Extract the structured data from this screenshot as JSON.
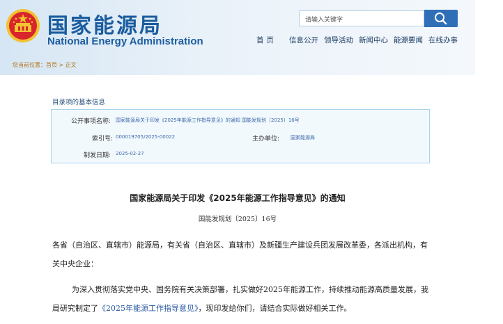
{
  "header": {
    "logo_cn": "国家能源局",
    "logo_en": "National Energy Administration",
    "emblem_icon": "national-emblem-icon",
    "search_placeholder": "请输入关键字",
    "search_icon": "search-icon",
    "nav": [
      "首页",
      "信息公开",
      "领导活动",
      "新闻中心",
      "能源要闻",
      "在线办事"
    ],
    "breadcrumb": "您当前位置：首页 > 正文",
    "colors": {
      "brand_blue": "#1a5c9e",
      "search_button": "#2f6fb7",
      "emblem_red": "#d8262c",
      "emblem_gold": "#f2c230"
    }
  },
  "info": {
    "section_title": "目录项的基本信息",
    "rows": {
      "title_label": "公开事项名称:",
      "title_value": "国家能源局关于印发《2025年能源工作指导意见》的通知 国能发规划〔2025〕16号",
      "index_label": "索引号:",
      "index_value": "000019705/2025-00022",
      "sponsor_label": "主办单位:",
      "sponsor_value": "国家能源局",
      "date_label": "制发日期:",
      "date_value": "2025-02-27"
    }
  },
  "article": {
    "title": "国家能源局关于印发《2025年能源工作指导意见》的通知",
    "doc_number": "国能发规划〔2025〕16号",
    "addressee_line1": "各省（自治区、直辖市）能源局，有关省（自治区、直辖市）及新疆生产建设兵团发展改革委，各派出机构，有",
    "addressee_line2": "关中央企业：",
    "body_line1": "为深入贯彻落实党中央、国务院有关决策部署，扎实做好2025年能源工作，持续推动能源高质量发展，我",
    "body_line2_prefix": "局研究制定了",
    "body_line2_link": "《2025年能源工作指导意见》",
    "body_line2_suffix": "，现印发给你们，请结合实际做好相关工作。"
  }
}
